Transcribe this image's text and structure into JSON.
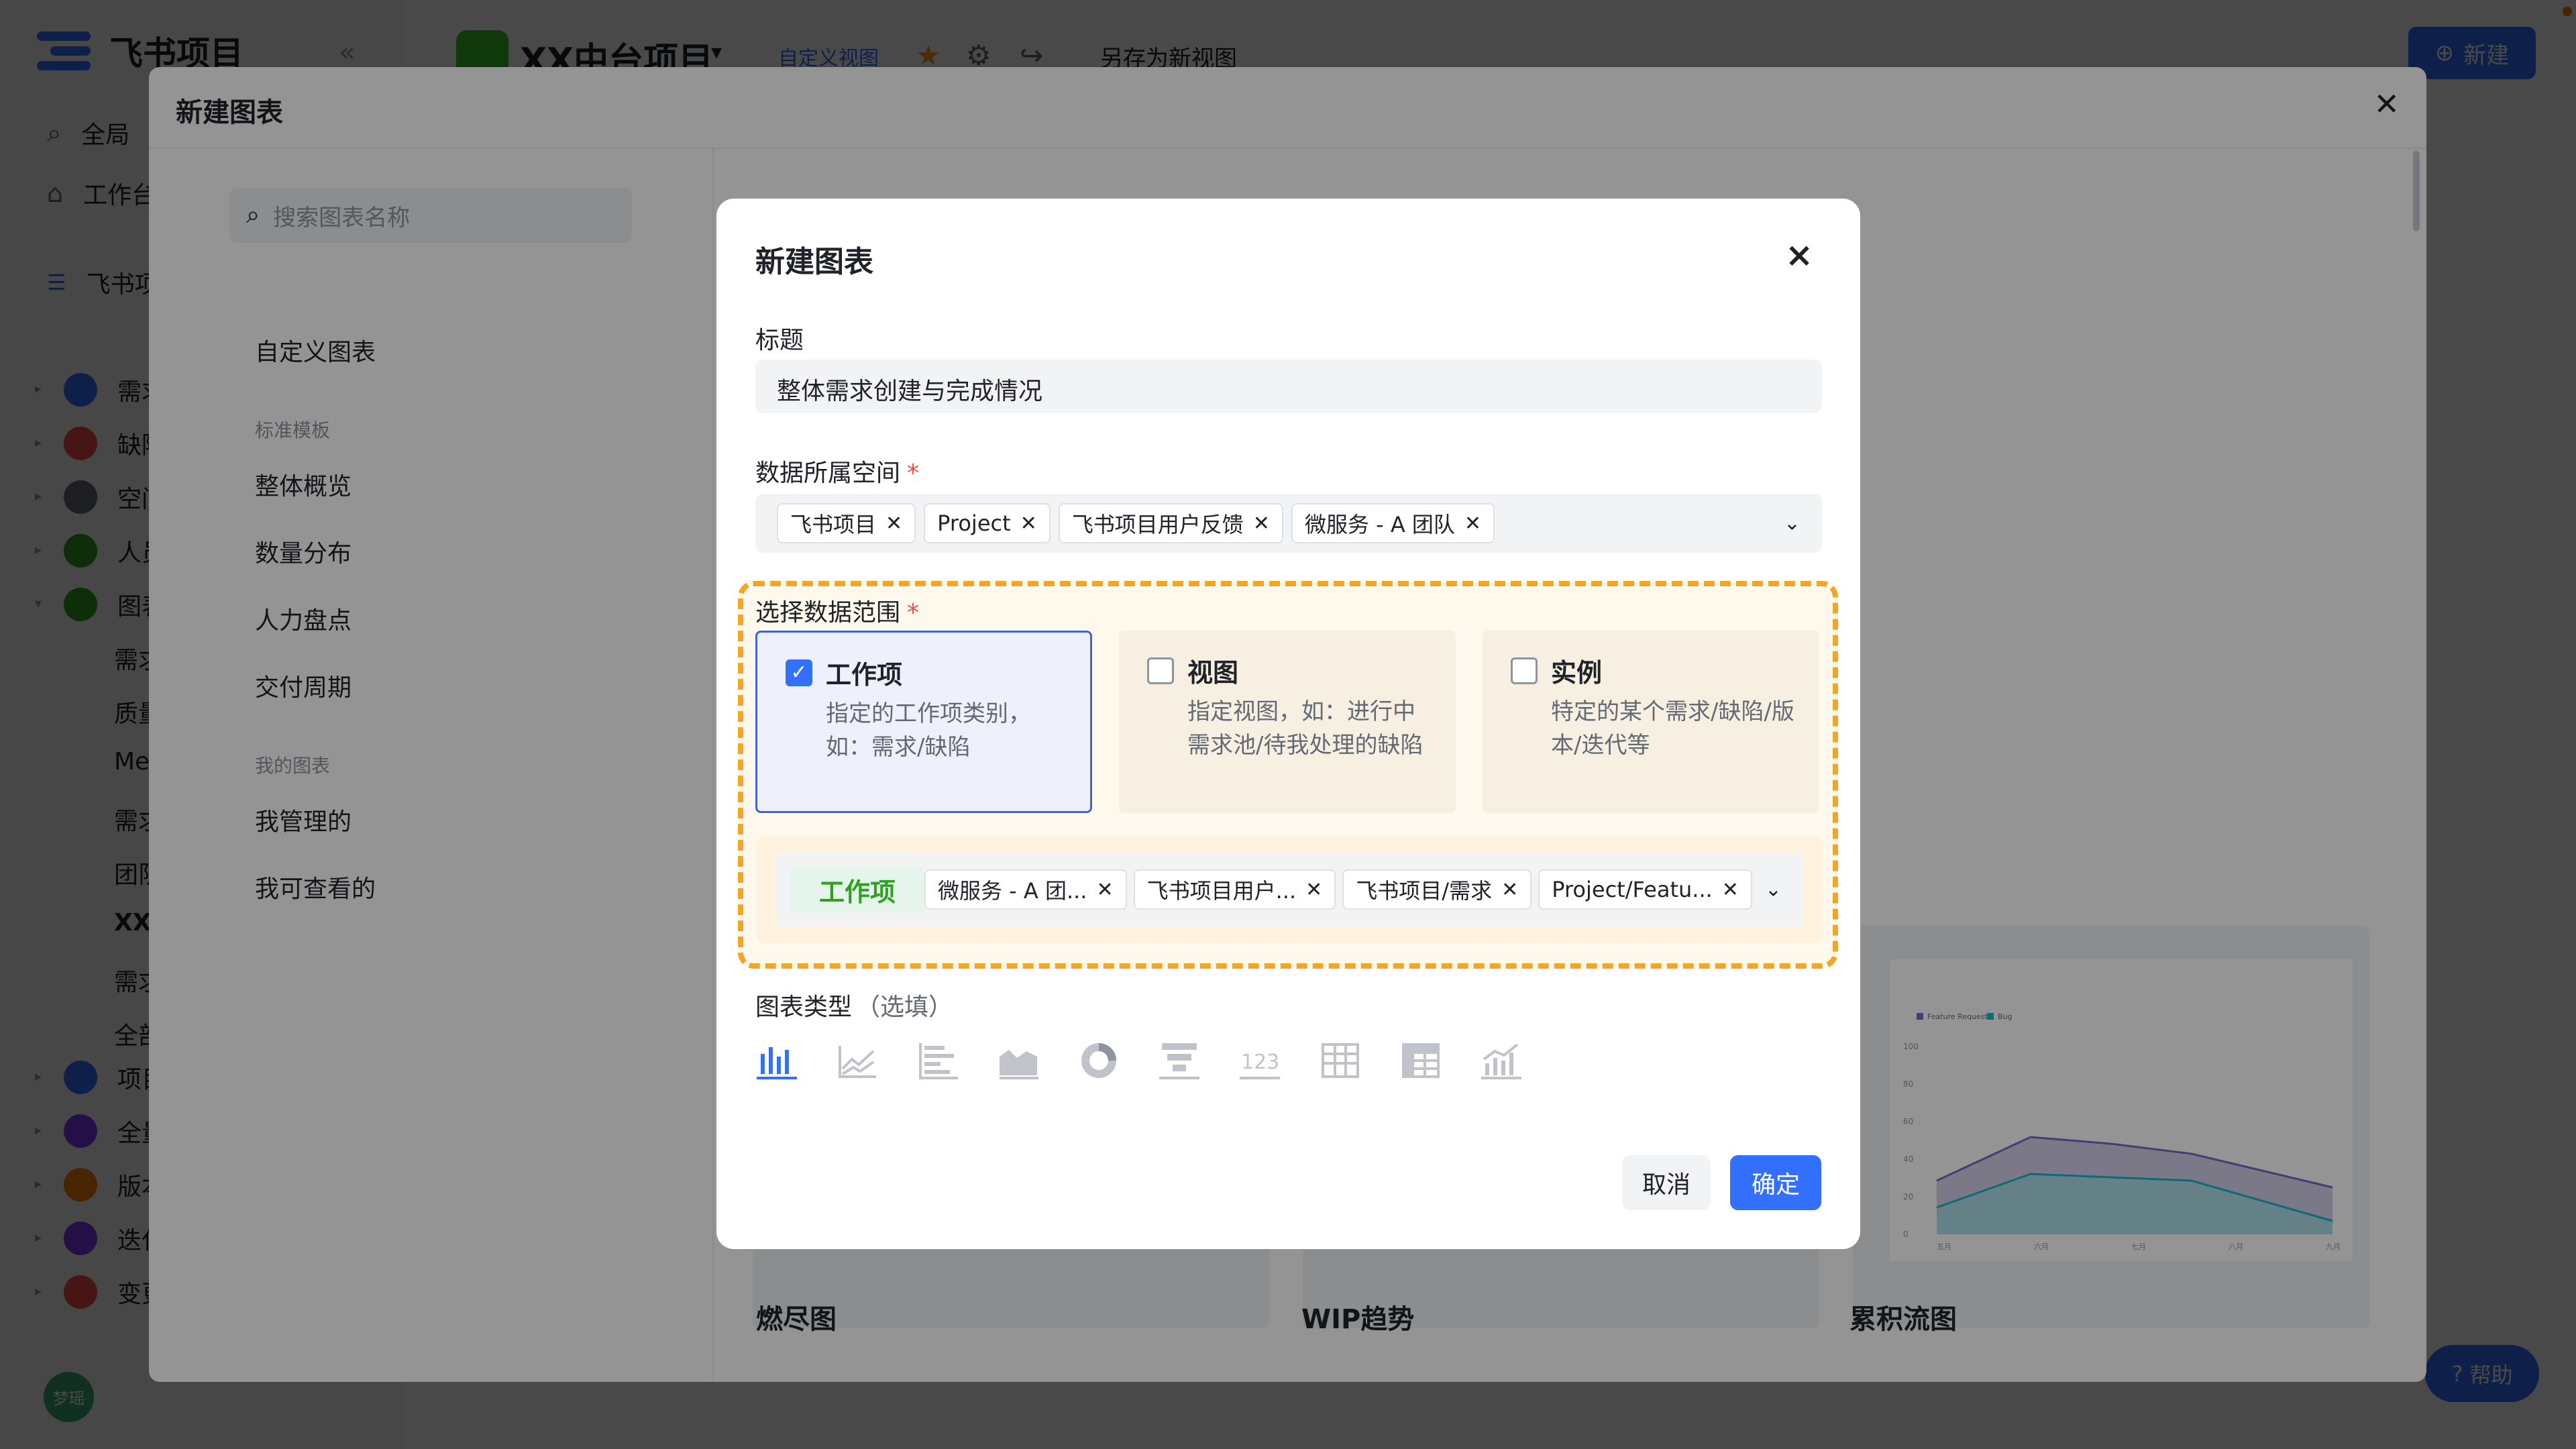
{
  "app": {
    "brand": "飞书项目",
    "collapse_icon": "«",
    "sidebar": {
      "search": "全局",
      "workbench": "工作台",
      "space": "飞书项",
      "items": [
        {
          "label": "需求",
          "color": "#3370ff"
        },
        {
          "label": "缺陷",
          "color": "#f54a45"
        },
        {
          "label": "空间",
          "color": "#646a73"
        },
        {
          "label": "人员",
          "color": "#2ea121"
        },
        {
          "label": "图表",
          "color": "#2ea121"
        }
      ],
      "sub_items": [
        "需求",
        "质量",
        "Me",
        "需求",
        "团队",
        "XX",
        "需求",
        "全部"
      ],
      "items_bottom": [
        {
          "label": "项目",
          "color": "#3370ff"
        },
        {
          "label": "全量",
          "color": "#7f3bf5"
        },
        {
          "label": "版本",
          "color": "#ff7d00"
        },
        {
          "label": "迭代",
          "color": "#7f3bf5"
        },
        {
          "label": "变更",
          "color": "#f54a45"
        }
      ],
      "avatar_text": "梦瑶"
    },
    "header": {
      "project_title": "XX中台项目",
      "view_tag": "自定义视图",
      "save_as": "另存为新视图",
      "new_button": "新建"
    },
    "help_button": "帮助"
  },
  "gallery": {
    "title": "新建图表",
    "search_placeholder": "搜索图表名称",
    "nav": {
      "custom": "自定义图表",
      "group_standard": "标准模板",
      "standard": [
        "整体概览",
        "数量分布",
        "人力盘点",
        "交付周期"
      ],
      "group_mine": "我的图表",
      "mine": [
        "我管理的",
        "我可查看的"
      ]
    },
    "cards": [
      "燃尽图",
      "WIP趋势",
      "累积流图"
    ],
    "preview_legend": [
      "Feature Request",
      "Bug"
    ],
    "preview_yticks": [
      "100",
      "80",
      "60",
      "40",
      "20",
      "0"
    ],
    "preview_xticks": [
      "五月",
      "六月",
      "七月",
      "八月",
      "九月"
    ]
  },
  "dialog": {
    "title": "新建图表",
    "close_icon": "×",
    "title_label": "标题",
    "title_value": "整体需求创建与完成情况",
    "space_label": "数据所属空间",
    "space_chips": [
      "飞书项目",
      "Project",
      "飞书项目用户反馈",
      "微服务 - A 团队"
    ],
    "scope_label": "选择数据范围",
    "required_mark": "*",
    "scope_options": [
      {
        "title": "工作项",
        "desc": "指定的工作项类别，如：需求/缺陷",
        "checked": true
      },
      {
        "title": "视图",
        "desc": "指定视图，如：进行中需求池/待我处理的缺陷",
        "checked": false
      },
      {
        "title": "实例",
        "desc": "特定的某个需求/缺陷/版本/迭代等",
        "checked": false
      }
    ],
    "workitem_tag": "工作项",
    "workitem_chips": [
      "微服务 - A 团...",
      "飞书项目用户...",
      "飞书项目/需求",
      "Project/Featu..."
    ],
    "chart_type_label": "图表类型",
    "chart_type_optional": "（选填）",
    "chart_types": [
      "bar-chart-icon",
      "line-chart-icon",
      "horizontal-bar-icon",
      "area-chart-icon",
      "donut-chart-icon",
      "funnel-chart-icon",
      "number-card-icon",
      "table-icon",
      "pivot-table-icon",
      "combo-chart-icon"
    ],
    "chart_types_selected": 0,
    "cancel": "取消",
    "confirm": "确定"
  },
  "colors": {
    "accent": "#3370ff",
    "highlight_border": "#f5a524",
    "highlight_bg": "#fff8ec",
    "workitem_tag_text": "#2ea121"
  }
}
